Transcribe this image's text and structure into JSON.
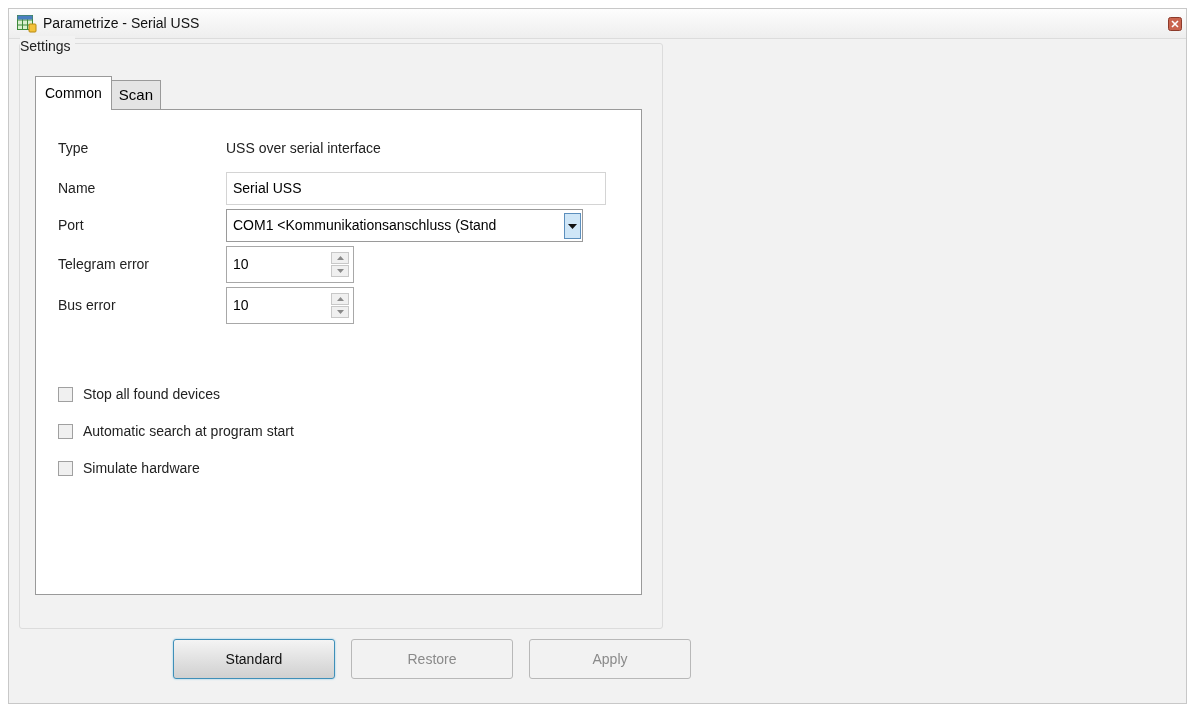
{
  "window": {
    "title": "Parametrize - Serial USS"
  },
  "group": {
    "label": "Settings"
  },
  "tabs": [
    {
      "label": "Common",
      "selected": true
    },
    {
      "label": "Scan",
      "selected": false
    }
  ],
  "fields": [
    {
      "kind": "text",
      "label": "Type",
      "value": "USS over serial interface"
    },
    {
      "kind": "input",
      "label": "Name",
      "value": "Serial USS"
    },
    {
      "kind": "dropdown",
      "label": "Port",
      "value": "COM1 <Kommunikationsanschluss (Stand"
    },
    {
      "kind": "spinner",
      "label": "Telegram error",
      "value": "10"
    },
    {
      "kind": "spinner",
      "label": "Bus error",
      "value": "10"
    }
  ],
  "checkboxes": [
    {
      "label": "Stop all found devices",
      "checked": false
    },
    {
      "label": "Automatic search at program start",
      "checked": false
    },
    {
      "label": "Simulate hardware",
      "checked": false
    }
  ],
  "buttons": [
    {
      "label": "Standard",
      "disabled": false,
      "focused": true
    },
    {
      "label": "Restore",
      "disabled": true,
      "focused": false
    },
    {
      "label": "Apply",
      "disabled": true,
      "focused": false
    }
  ]
}
